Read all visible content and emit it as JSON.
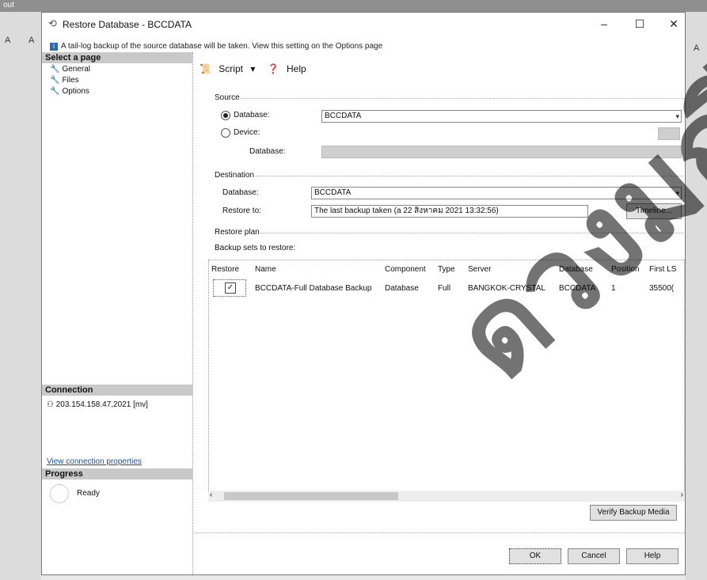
{
  "background": {
    "top_label": "out",
    "left_glyphs": [
      "A",
      "A"
    ],
    "right_glyph": "A"
  },
  "window": {
    "title": "Restore Database - BCCDATA",
    "controls": {
      "minimize": "–",
      "maximize": "☐",
      "close": "✕"
    }
  },
  "banner": "A tail-log backup of the source database will be taken. View this setting on the Options page",
  "left_pane": {
    "select_page_header": "Select a page",
    "pages": [
      "General",
      "Files",
      "Options"
    ],
    "connection_header": "Connection",
    "connection_value": "203.154.158.47,2021 [mv]",
    "view_connection_link": "View connection properties",
    "progress_header": "Progress",
    "progress_status": "Ready"
  },
  "toolbar": {
    "script_label": "Script",
    "help_label": "Help"
  },
  "source": {
    "section_label": "Source",
    "database_radio_label": "Database:",
    "database_value": "BCCDATA",
    "device_radio_label": "Device:",
    "device_database_label": "Database:"
  },
  "destination": {
    "section_label": "Destination",
    "database_label": "Database:",
    "database_value": "BCCDATA",
    "restore_to_label": "Restore to:",
    "restore_to_value": "The last backup taken (a  22 สิงหาคม 2021 13:32:56)",
    "timeline_button": "Timeline..."
  },
  "restore_plan": {
    "section_label": "Restore plan",
    "backup_sets_label": "Backup sets to restore:",
    "columns": [
      "Restore",
      "Name",
      "Component",
      "Type",
      "Server",
      "Database",
      "Position",
      "First LS"
    ],
    "rows": [
      {
        "name": "BCCDATA-Full Database Backup",
        "component": "Database",
        "type": "Full",
        "server": "BANGKOK-CRYSTAL",
        "database": "BCCDATA",
        "position": "1",
        "first_lsn": "35500("
      }
    ]
  },
  "verify_button": "Verify Backup Media",
  "footer": {
    "ok": "OK",
    "cancel": "Cancel",
    "help": "Help"
  },
  "watermark": "ดวงมณี"
}
